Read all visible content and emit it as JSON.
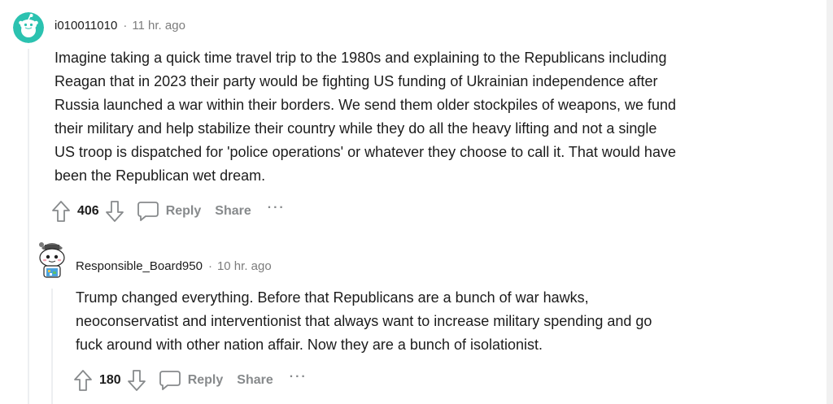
{
  "comments": [
    {
      "username": "i010011010",
      "separator": "·",
      "timestamp": "11 hr. ago",
      "body_lines": [
        "Imagine taking a quick time travel trip to the 1980s and explaining to the Republicans including",
        "Reagan that in 2023 their party would be fighting US funding of Ukrainian independence after",
        "Russia launched a war within their borders. We send them older stockpiles of weapons, we fund",
        "their military and help stabilize their country while they do all the heavy lifting and not a single",
        "US troop is dispatched for 'police operations' or whatever they choose to call it. That would have",
        "been the Republican wet dream."
      ],
      "score": "406",
      "reply_label": "Reply",
      "share_label": "Share",
      "more_label": "···"
    },
    {
      "username": "Responsible_Board950",
      "separator": "·",
      "timestamp": "10 hr. ago",
      "body_lines": [
        "Trump changed everything. Before that Republicans are a bunch of war hawks,",
        "neoconservatist and interventionist that always want to increase military spending and go",
        "fuck around with other nation affair. Now they are a bunch of isolationist."
      ],
      "score": "180",
      "reply_label": "Reply",
      "share_label": "Share",
      "more_label": "···"
    }
  ],
  "colors": {
    "text": "#1c1c1c",
    "meta": "#7c7c7c",
    "action": "#878a8c",
    "thread_line": "#edeff1",
    "avatar_teal": "#2bc2b0"
  },
  "icons": {
    "avatar_1": "reddit-snoo-avatar",
    "avatar_2": "custom-snoo-avatar",
    "upvote": "upvote-arrow-icon",
    "downvote": "downvote-arrow-icon",
    "reply": "speech-bubble-icon",
    "more": "ellipsis-icon"
  }
}
